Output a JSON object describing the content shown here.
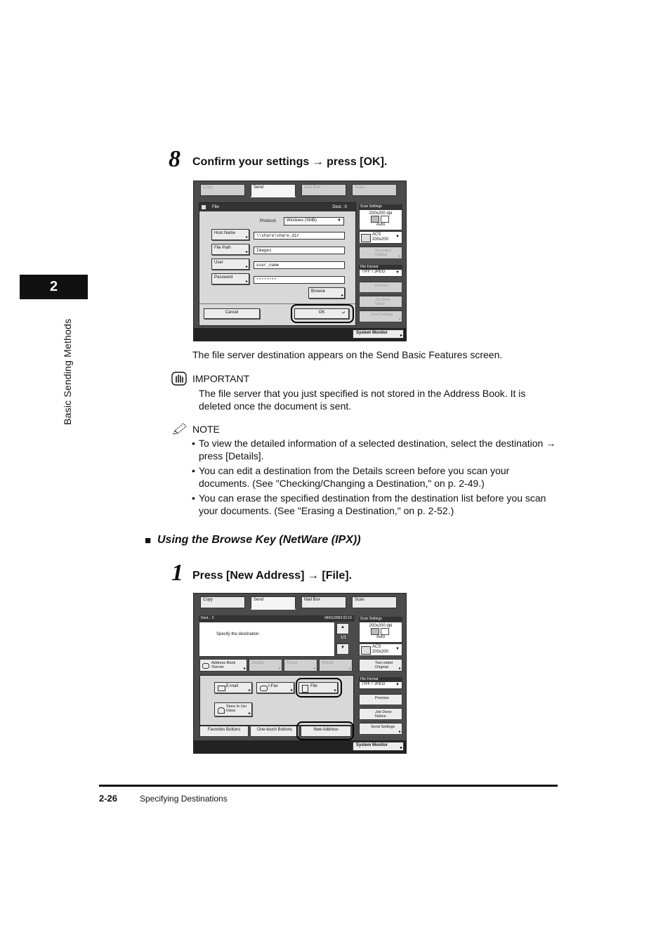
{
  "chapter": {
    "number": "2",
    "title": "Basic Sending Methods"
  },
  "step8": {
    "number": "8",
    "heading": "Confirm your settings → press [OK].",
    "after_text": "The file server destination appears on the Send Basic Features screen."
  },
  "screen1": {
    "tabs": [
      "Copy",
      "Send",
      "Mail Box",
      "Scan"
    ],
    "title": "File",
    "dest_count": "Dest. :0",
    "protocol_label": "Protocol:",
    "protocol_value": "Windows (SMB)",
    "fields": [
      {
        "label": "Host Name",
        "value": "\\\\share\\share_dir"
      },
      {
        "label": "File Path",
        "value": "Images"
      },
      {
        "label": "User",
        "value": "user_name"
      },
      {
        "label": "Password",
        "value": "********"
      }
    ],
    "browse": "Browse",
    "cancel": "Cancel",
    "ok": "OK",
    "right_panel": {
      "scan_settings": "Scan Settings",
      "resolution": "200x200 dpi",
      "mode": "Auto",
      "size_top": "ACS",
      "size_bottom": "200x200",
      "two_sided": "Two-sided Original",
      "file_format_hdr": "File Format",
      "file_format": "TIFF / JPEG",
      "preview": "Preview",
      "job_done": "Job Done Notice",
      "send_settings": "Send Settings"
    },
    "system_monitor": "System Monitor"
  },
  "important": {
    "label": "IMPORTANT",
    "text": "The file server that you just specified is not stored in the Address Book. It is deleted once the document is sent."
  },
  "note": {
    "label": "NOTE",
    "items": [
      "To view the detailed information of a selected destination, select the destination → press [Details].",
      "You can edit a destination from the Details screen before you scan your documents. (See \"Checking/Changing a Destination,\" on p. 2-49.)",
      "You can erase the specified destination from the destination list before you scan your documents. (See \"Erasing a Destination,\" on p. 2-52.)"
    ]
  },
  "section": {
    "marker": "■",
    "title": "Using the Browse Key (NetWare (IPX))"
  },
  "step1": {
    "number": "1",
    "heading": "Press [New Address] → [File]."
  },
  "screen2": {
    "tabs": [
      "Copy",
      "Send",
      "Mail Box",
      "Scan"
    ],
    "dest_bar": "Dest. :  0",
    "datetime": "04/01/2003 02:16",
    "message": "Specify the destination.",
    "page": "1/1",
    "row_buttons": [
      "Address Book /Server",
      "Details",
      "Erase",
      "Recall"
    ],
    "type_buttons": [
      "E-mail",
      "I-Fax",
      "File",
      "Store In Usr Inbox"
    ],
    "bottom_buttons": [
      "Favorites Buttons",
      "One-touch Buttons",
      "New Address"
    ],
    "right_panel": {
      "scan_settings": "Scan Settings",
      "resolution": "200x200 dpi",
      "mode": "Auto",
      "size_top": "ACS",
      "size_bottom": "200x200",
      "two_sided": "Two-sided Original",
      "file_format_hdr": "File Format",
      "file_format": "TIFF / JPEG",
      "preview": "Preview",
      "job_done": "Job Done Notice",
      "send_settings": "Send Settings"
    },
    "system_monitor": "System Monitor"
  },
  "footer": {
    "page": "2-26",
    "title": "Specifying Destinations"
  }
}
